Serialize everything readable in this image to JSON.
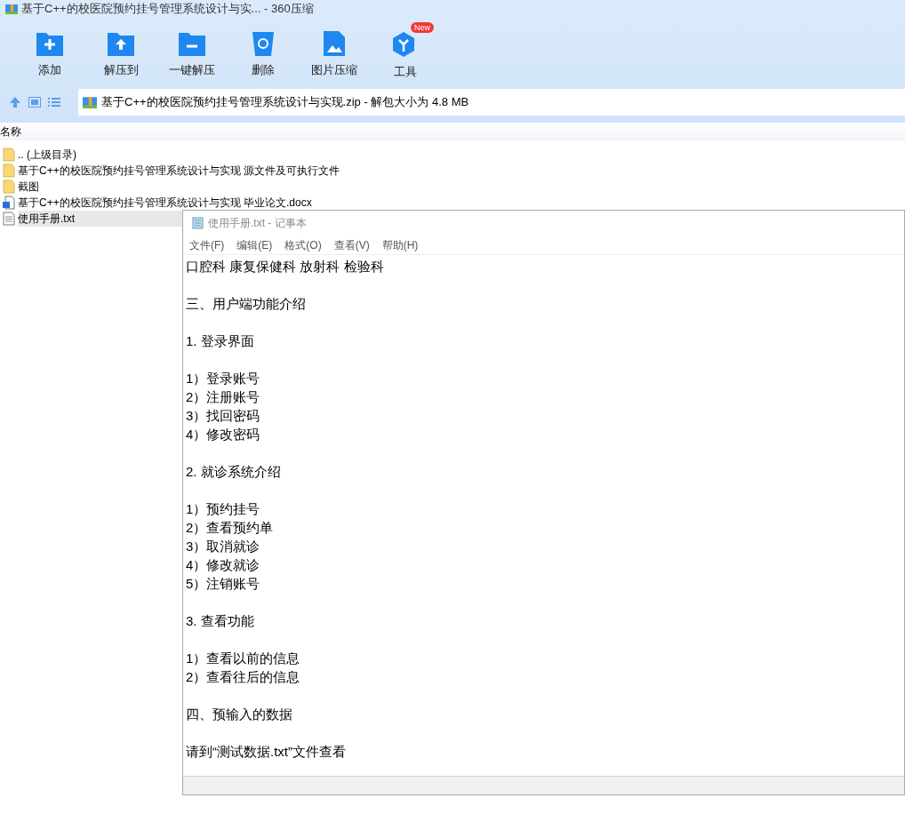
{
  "window": {
    "title": "基于C++的校医院预约挂号管理系统设计与实... - 360压缩"
  },
  "toolbar": [
    {
      "kind": "add",
      "label": "添加"
    },
    {
      "kind": "extract",
      "label": "解压到"
    },
    {
      "kind": "oneclick",
      "label": "一键解压"
    },
    {
      "kind": "delete",
      "label": "删除"
    },
    {
      "kind": "image",
      "label": "图片压缩"
    },
    {
      "kind": "tools",
      "label": "工具",
      "badge": "New"
    }
  ],
  "address": {
    "path": "基于C++的校医院预约挂号管理系统设计与实现.zip - 解包大小为 4.8 MB"
  },
  "file_list": {
    "column": "名称",
    "rows": [
      {
        "kind": "folder",
        "name": ".. (上级目录)",
        "selected": false
      },
      {
        "kind": "folder",
        "name": "基于C++的校医院预约挂号管理系统设计与实现 源文件及可执行文件",
        "selected": false
      },
      {
        "kind": "folder",
        "name": "截图",
        "selected": false
      },
      {
        "kind": "docx",
        "name": "基于C++的校医院预约挂号管理系统设计与实现 毕业论文.docx",
        "selected": false
      },
      {
        "kind": "txt",
        "name": "使用手册.txt",
        "selected": true
      }
    ]
  },
  "notepad": {
    "title": "使用手册.txt - 记事本",
    "menu": [
      "文件(F)",
      "编辑(E)",
      "格式(O)",
      "查看(V)",
      "帮助(H)"
    ],
    "paragraphs": [
      [
        "口腔科 康复保健科 放射科 检验科"
      ],
      [
        "三、用户端功能介绍"
      ],
      [
        "1. 登录界面"
      ],
      [
        "1）登录账号",
        "2）注册账号",
        "3）找回密码",
        "4）修改密码"
      ],
      [
        "2. 就诊系统介绍"
      ],
      [
        "1）预约挂号",
        "2）查看预约单",
        "3）取消就诊",
        "4）修改就诊",
        "5）注销账号"
      ],
      [
        "3. 查看功能"
      ],
      [
        "1）查看以前的信息",
        "2）查看往后的信息"
      ],
      [
        "四、预输入的数据"
      ],
      [
        "请到“测试数据.txt”文件查看"
      ]
    ]
  }
}
